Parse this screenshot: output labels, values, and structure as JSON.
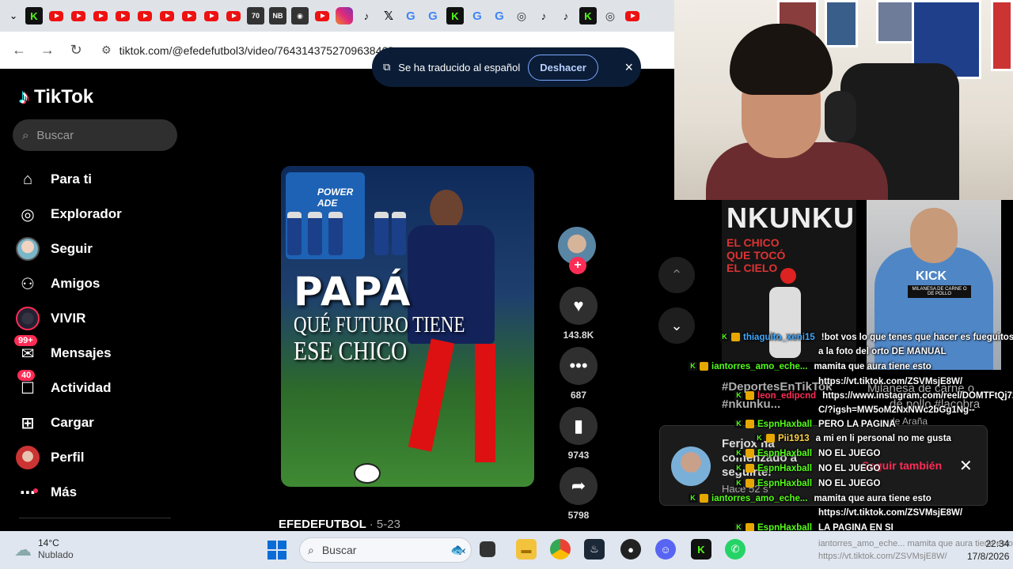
{
  "browser": {
    "url": "tiktok.com/@efedefutbol3/video/7643143752709638463...",
    "translate_popup": {
      "message": "Se ha traducido al español",
      "undo_label": "Deshacer",
      "close_icon": "×"
    }
  },
  "tiktok": {
    "logo_text": "TikTok",
    "search_placeholder": "Buscar",
    "nav": [
      {
        "label": "Para ti",
        "icon": "home-icon"
      },
      {
        "label": "Explorador",
        "icon": "compass-icon"
      },
      {
        "label": "Seguir",
        "icon": "following-avatar"
      },
      {
        "label": "Amigos",
        "icon": "friends-icon"
      },
      {
        "label": "VIVIR",
        "icon": "live-icon"
      },
      {
        "label": "Mensajes",
        "icon": "messages-icon",
        "badge": "99+"
      },
      {
        "label": "Actividad",
        "icon": "activity-icon",
        "badge": "40"
      },
      {
        "label": "Cargar",
        "icon": "upload-icon"
      },
      {
        "label": "Perfil",
        "icon": "profile-avatar"
      },
      {
        "label": "Más",
        "icon": "more-icon"
      }
    ],
    "video": {
      "caption_line1": "PAPÁ",
      "caption_line2": "QUÉ FUTURO TIENE",
      "caption_line3": "ESE CHICO",
      "cooler_brand": "POWER ADE",
      "author": "EFEDEFUTBOL",
      "date": "· 5-23"
    },
    "actions": {
      "likes": "143.8K",
      "comments": "687",
      "saves": "9743",
      "shares": "5798"
    },
    "follow_card": {
      "name": "Ferjox ha comenzado a seguirte.",
      "button": "Seguir también",
      "time": "Hace 52 s"
    },
    "ghost_text": {
      "hashtag1": "#DeportesEnTikTok",
      "hashtag2": "#nkunku...",
      "milanesa": "Milanesa de carne o",
      "pollo": "de pollo #lacobra",
      "arana": "de Araña"
    }
  },
  "stream": {
    "nkunku_title": "NKUNKU",
    "nkunku_sub": "EL CHICO QUE TOCÓ EL CIELO",
    "kick_text": "KICK",
    "kick_sub": "MILANESA DE CARNE O DE POLLO",
    "chat": [
      {
        "user": "thiaguito_xeni15",
        "color": "#3fa9ff",
        "msg": "!bot vos lo que tenes que hacer es fueguitos"
      },
      {
        "user": "",
        "color": "#fff",
        "msg": "a la foto del orto DE MANUAL"
      },
      {
        "user": "iantorres_amo_eche...",
        "color": "#53fc18",
        "msg": "mamita que aura tiene esto"
      },
      {
        "user": "",
        "color": "#fff",
        "msg": "https://vt.tiktok.com/ZSVMsjE8W/"
      },
      {
        "user": "leon_edipcnd",
        "color": "#fe2c55",
        "msg": "https://www.instagram.com/reel/DOMTFtQj72"
      },
      {
        "user": "",
        "color": "#fff",
        "msg": "C/?igsh=MW5oM2NxNWc2bGg1Ng--"
      },
      {
        "user": "EspnHaxball",
        "color": "#53fc18",
        "msg": "PERO LA PAGINA"
      },
      {
        "user": "Pii1913",
        "color": "#ffd23f",
        "msg": "a mi en li personal no me gusta"
      },
      {
        "user": "EspnHaxball",
        "color": "#53fc18",
        "msg": "NO EL JUEGO"
      },
      {
        "user": "EspnHaxball",
        "color": "#53fc18",
        "msg": "NO EL JUEGO"
      },
      {
        "user": "EspnHaxball",
        "color": "#53fc18",
        "msg": "NO EL JUEGO"
      },
      {
        "user": "iantorres_amo_eche...",
        "color": "#53fc18",
        "msg": "mamita que aura tiene esto"
      },
      {
        "user": "",
        "color": "#fff",
        "msg": "https://vt.tiktok.com/ZSVMsjE8W/"
      },
      {
        "user": "EspnHaxball",
        "color": "#53fc18",
        "msg": "LA PAGINA EN SI"
      }
    ]
  },
  "taskbar": {
    "temperature": "14°C",
    "weather": "Nublado",
    "search_placeholder": "Buscar",
    "time": "22:34",
    "date": "17/8/2026",
    "ghost_line1": "iantorres_amo_eche...  mamita que aura tiene esto",
    "ghost_line2": "https://vt.tiktok.com/ZSVMsjE8W/"
  },
  "colors": {
    "tiktok_red": "#fe2c55",
    "kick_green": "#53fc18",
    "translate_bg": "#0b1d36"
  }
}
